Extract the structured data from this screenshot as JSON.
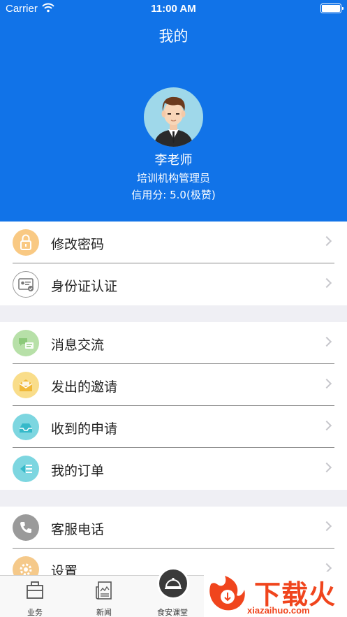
{
  "status_bar": {
    "carrier": "Carrier",
    "time": "11:00 AM"
  },
  "nav": {
    "title": "我的"
  },
  "profile": {
    "name": "李老师",
    "role": "培训机构管理员",
    "credit": "信用分: 5.0(极赞)"
  },
  "menu": {
    "group1": [
      {
        "label": "修改密码",
        "icon": "lock-icon",
        "color": "#f9c983"
      },
      {
        "label": "身份证认证",
        "icon": "id-card-icon",
        "color": "#ffffff"
      }
    ],
    "group2": [
      {
        "label": "消息交流",
        "icon": "chat-icon",
        "color": "#b7e0a8"
      },
      {
        "label": "发出的邀请",
        "icon": "invite-icon",
        "color": "#f9dd8a"
      },
      {
        "label": "收到的申请",
        "icon": "inbox-icon",
        "color": "#7dd6e0"
      },
      {
        "label": "我的订单",
        "icon": "order-list-icon",
        "color": "#7dd6e0"
      }
    ],
    "group3": [
      {
        "label": "客服电话",
        "icon": "phone-icon",
        "color": "#9a9a9a"
      },
      {
        "label": "设置",
        "icon": "gear-icon",
        "color": "#f5c98a"
      }
    ]
  },
  "tabbar": {
    "tabs": [
      {
        "label": "业务",
        "icon": "briefcase-icon"
      },
      {
        "label": "新闻",
        "icon": "newspaper-icon"
      },
      {
        "label": "食安课堂",
        "icon": "food-cover-icon"
      }
    ]
  },
  "watermark": {
    "text": "下载火",
    "url": "xiazaihuo.com"
  },
  "colors": {
    "header": "#1173e8",
    "accent_orange": "#f0451d"
  }
}
